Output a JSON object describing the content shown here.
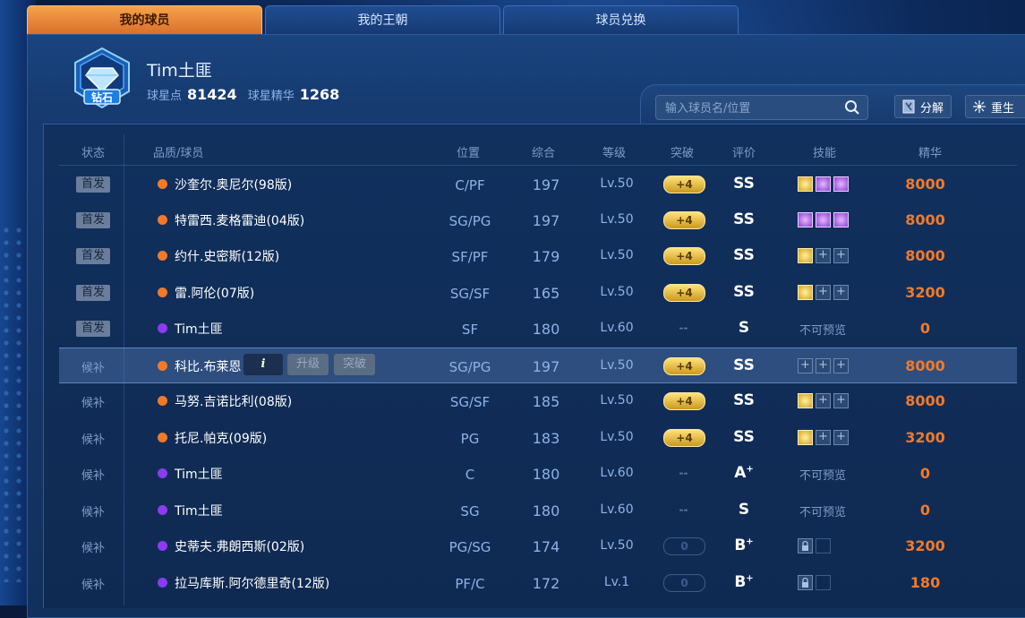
{
  "tabs": [
    {
      "label": "我的球员",
      "active": true
    },
    {
      "label": "我的王朝",
      "active": false
    },
    {
      "label": "球员兑换",
      "active": false
    }
  ],
  "profile": {
    "tier_badge_text": "钻石",
    "name": "Tim土匪",
    "star_points_label": "球星点",
    "star_points": "81424",
    "essence_label": "球星精华",
    "essence": "1268"
  },
  "search": {
    "placeholder": "输入球员名/位置"
  },
  "toolbar": {
    "decompose_label": "分解",
    "rebirth_label": "重生"
  },
  "columns": [
    "状态",
    "品质/球员",
    "位置",
    "综合",
    "等级",
    "突破",
    "评价",
    "技能",
    "精华"
  ],
  "row_actions": {
    "info": "i",
    "upgrade": "升级",
    "breakthrough": "突破"
  },
  "colors": {
    "orange_tier": "#f07a2a",
    "purple_tier": "#8b3bf0",
    "accent": "#f6a24a"
  },
  "rows": [
    {
      "status": "首发",
      "starter": true,
      "tier": "orange",
      "name": "沙奎尔.奥尼尔(98版)",
      "pos": "C/PF",
      "ovr": "197",
      "lvl": "Lv.50",
      "brk": "+4",
      "brk_type": "gold",
      "rank": "SS",
      "rank_sup": "",
      "skills": [
        "gold",
        "purp",
        "purp"
      ],
      "noprev": "",
      "essence": "8000"
    },
    {
      "status": "首发",
      "starter": true,
      "tier": "orange",
      "name": "特雷西.麦格雷迪(04版)",
      "pos": "SG/PG",
      "ovr": "197",
      "lvl": "Lv.50",
      "brk": "+4",
      "brk_type": "gold",
      "rank": "SS",
      "rank_sup": "",
      "skills": [
        "purp",
        "purp",
        "purp"
      ],
      "noprev": "",
      "essence": "8000"
    },
    {
      "status": "首发",
      "starter": true,
      "tier": "orange",
      "name": "约什.史密斯(12版)",
      "pos": "SF/PF",
      "ovr": "179",
      "lvl": "Lv.50",
      "brk": "+4",
      "brk_type": "gold",
      "rank": "SS",
      "rank_sup": "",
      "skills": [
        "gold",
        "plus",
        "plus"
      ],
      "noprev": "",
      "essence": "8000"
    },
    {
      "status": "首发",
      "starter": true,
      "tier": "orange",
      "name": "雷.阿伦(07版)",
      "pos": "SG/SF",
      "ovr": "165",
      "lvl": "Lv.50",
      "brk": "+4",
      "brk_type": "gold",
      "rank": "SS",
      "rank_sup": "",
      "skills": [
        "gold",
        "plus",
        "plus"
      ],
      "noprev": "",
      "essence": "3200"
    },
    {
      "status": "首发",
      "starter": true,
      "tier": "purple",
      "name": "Tim土匪",
      "pos": "SF",
      "ovr": "180",
      "lvl": "Lv.60",
      "brk": "--",
      "brk_type": "dash",
      "rank": "S",
      "rank_sup": "",
      "skills": [],
      "noprev": "不可预览",
      "essence": "0"
    },
    {
      "status": "候补",
      "starter": false,
      "tier": "orange",
      "name": "科比.布莱恩",
      "pos": "SG/PG",
      "ovr": "197",
      "lvl": "Lv.50",
      "brk": "+4",
      "brk_type": "gold",
      "rank": "SS",
      "rank_sup": "",
      "skills": [
        "plus",
        "plus",
        "plus"
      ],
      "noprev": "",
      "essence": "8000",
      "selected": true
    },
    {
      "status": "候补",
      "starter": false,
      "tier": "orange",
      "name": "马努.吉诺比利(08版)",
      "pos": "SG/SF",
      "ovr": "185",
      "lvl": "Lv.50",
      "brk": "+4",
      "brk_type": "gold",
      "rank": "SS",
      "rank_sup": "",
      "skills": [
        "gold",
        "plus",
        "plus"
      ],
      "noprev": "",
      "essence": "8000"
    },
    {
      "status": "候补",
      "starter": false,
      "tier": "orange",
      "name": "托尼.帕克(09版)",
      "pos": "PG",
      "ovr": "183",
      "lvl": "Lv.50",
      "brk": "+4",
      "brk_type": "gold",
      "rank": "SS",
      "rank_sup": "",
      "skills": [
        "gold",
        "plus",
        "plus"
      ],
      "noprev": "",
      "essence": "3200"
    },
    {
      "status": "候补",
      "starter": false,
      "tier": "purple",
      "name": "Tim土匪",
      "pos": "C",
      "ovr": "180",
      "lvl": "Lv.60",
      "brk": "--",
      "brk_type": "dash",
      "rank": "A",
      "rank_sup": "+",
      "skills": [],
      "noprev": "不可预览",
      "essence": "0"
    },
    {
      "status": "候补",
      "starter": false,
      "tier": "purple",
      "name": "Tim土匪",
      "pos": "SG",
      "ovr": "180",
      "lvl": "Lv.60",
      "brk": "--",
      "brk_type": "dash",
      "rank": "S",
      "rank_sup": "",
      "skills": [],
      "noprev": "不可预览",
      "essence": "0"
    },
    {
      "status": "候补",
      "starter": false,
      "tier": "purple",
      "name": "史蒂夫.弗朗西斯(02版)",
      "pos": "PG/SG",
      "ovr": "174",
      "lvl": "Lv.50",
      "brk": "0",
      "brk_type": "empty",
      "rank": "B",
      "rank_sup": "+",
      "skills": [
        "lock",
        "blank"
      ],
      "noprev": "",
      "essence": "3200"
    },
    {
      "status": "候补",
      "starter": false,
      "tier": "purple",
      "name": "拉马库斯.阿尔德里奇(12版)",
      "pos": "PF/C",
      "ovr": "172",
      "lvl": "Lv.1",
      "brk": "0",
      "brk_type": "empty",
      "rank": "B",
      "rank_sup": "+",
      "skills": [
        "lock",
        "blank"
      ],
      "noprev": "",
      "essence": "180"
    }
  ]
}
